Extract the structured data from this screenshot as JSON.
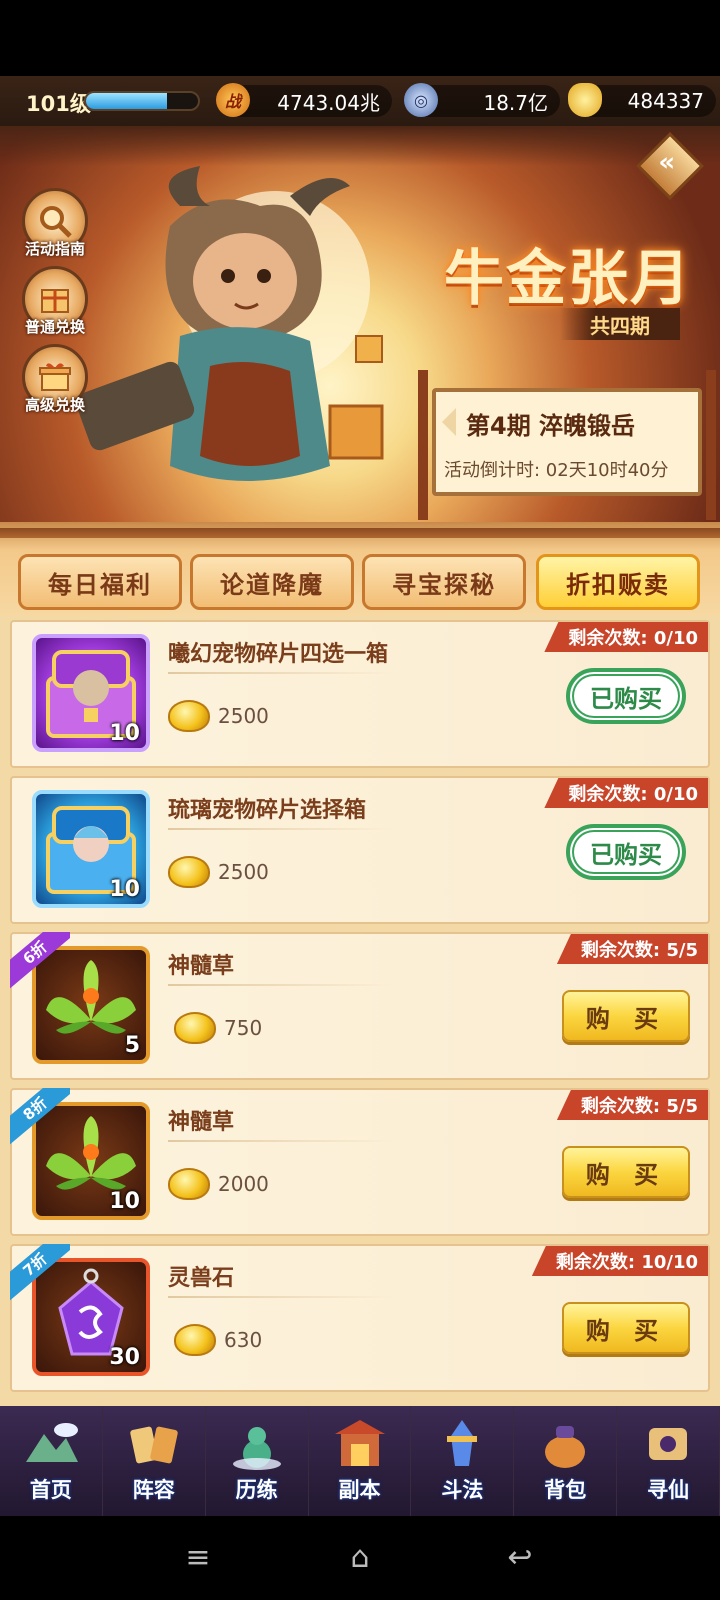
{
  "resources": {
    "level": "101级",
    "xp_fraction": 0.72,
    "power_icon": "战",
    "power": "4743.04兆",
    "coins": "18.7亿",
    "gold": "484337"
  },
  "banner": {
    "title": "牛金张月",
    "period_tag": "共四期",
    "stage_title": "第4期  淬魄锻岳",
    "countdown": "活动倒计时: 02天10时40分",
    "side_buttons": [
      {
        "label": "活动指南",
        "icon": "magnifier-icon"
      },
      {
        "label": "普通兑换",
        "icon": "gift-box-icon"
      },
      {
        "label": "高级兑换",
        "icon": "gift-icon"
      }
    ]
  },
  "tabs": [
    "每日福利",
    "论道降魔",
    "寻宝探秘",
    "折扣贩卖"
  ],
  "active_tab": 3,
  "items": [
    {
      "name": "曦幻宠物碎片四选一箱",
      "qty": "10",
      "price": "2500",
      "remaining": "剩余次数: 0/10",
      "status": "已购买",
      "discount": ""
    },
    {
      "name": "琉璃宠物碎片选择箱",
      "qty": "10",
      "price": "2500",
      "remaining": "剩余次数: 0/10",
      "status": "已购买",
      "discount": ""
    },
    {
      "name": "神髓草",
      "qty": "5",
      "price": "750",
      "remaining": "剩余次数: 5/5",
      "status": "购 买",
      "discount": "6折"
    },
    {
      "name": "神髓草",
      "qty": "10",
      "price": "2000",
      "remaining": "剩余次数: 5/5",
      "status": "购 买",
      "discount": "8折"
    },
    {
      "name": "灵兽石",
      "qty": "30",
      "price": "630",
      "remaining": "剩余次数: 10/10",
      "status": "购 买",
      "discount": "7折"
    }
  ],
  "nav": [
    "首页",
    "阵容",
    "历练",
    "副本",
    "斗法",
    "背包",
    "寻仙"
  ],
  "system_nav": {
    "menu": "≡",
    "home": "⌂",
    "back": "↩"
  },
  "colors": {
    "accent_gold": "#ffcf36",
    "bought_green": "#3aa35a",
    "remain_red": "#c8452a"
  }
}
